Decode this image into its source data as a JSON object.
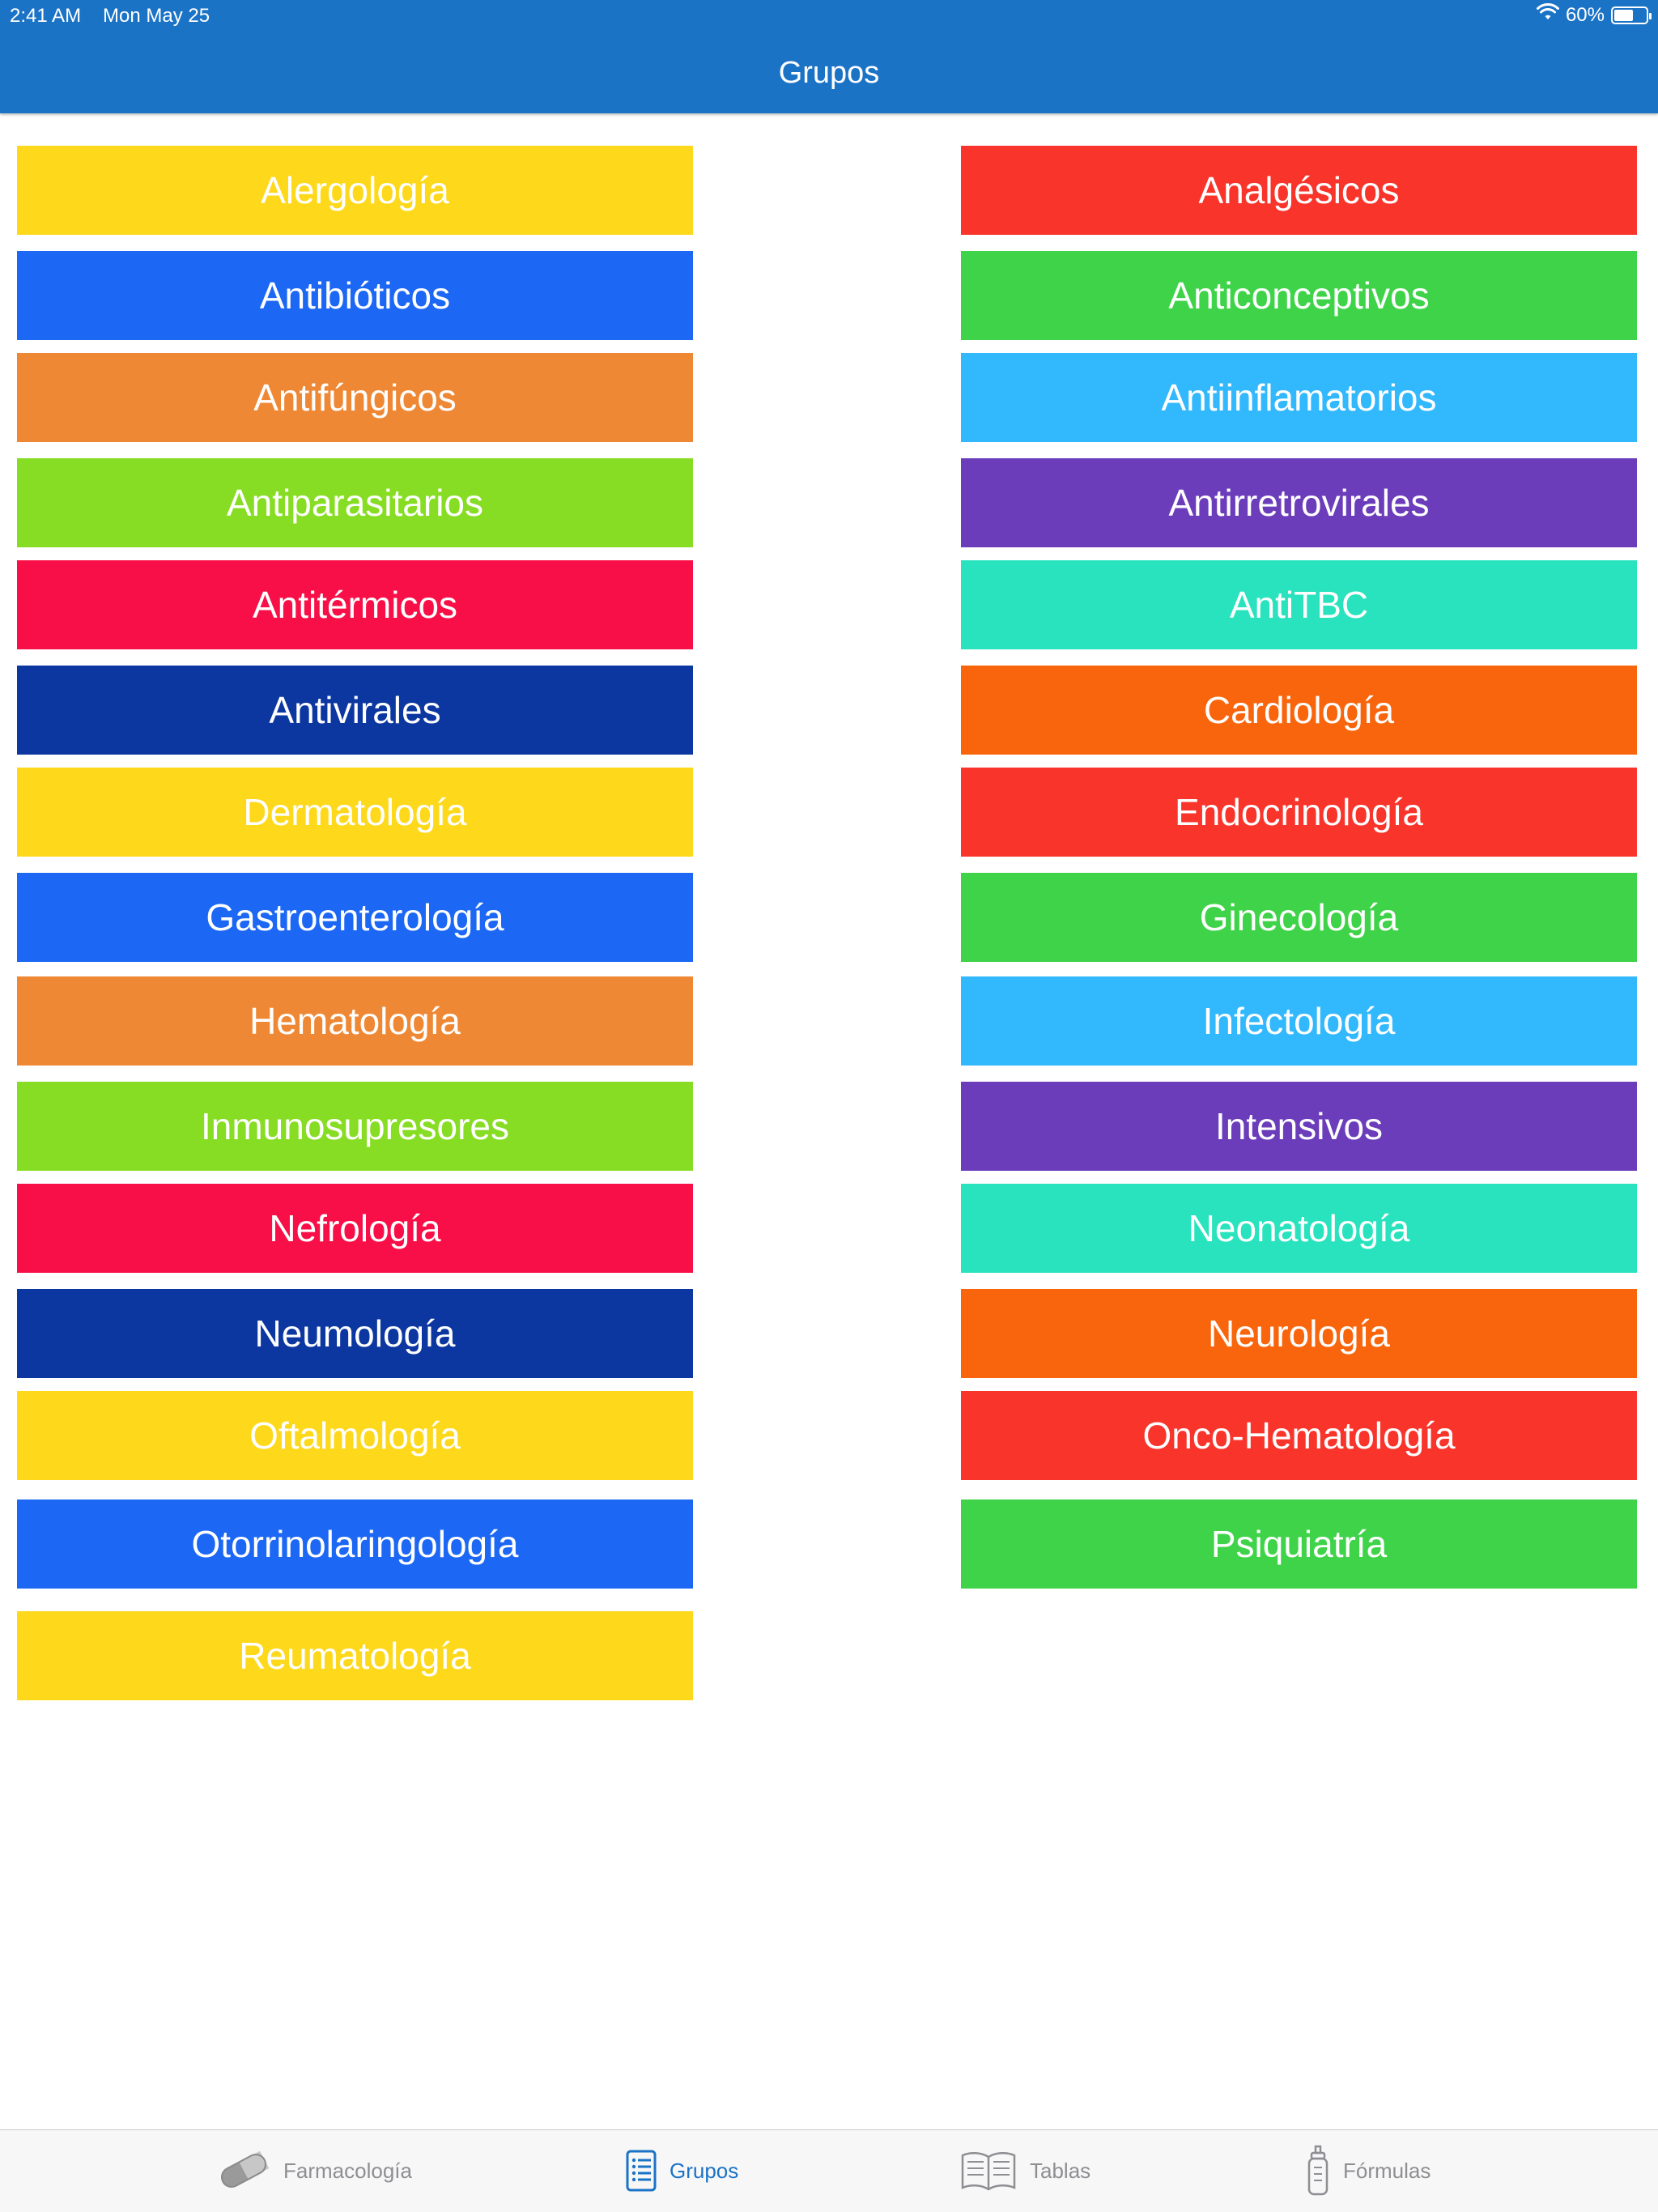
{
  "status": {
    "time": "2:41 AM",
    "date": "Mon May 25",
    "battery": "60%",
    "battery_level": 0.6
  },
  "nav": {
    "title": "Grupos"
  },
  "groups": {
    "left": [
      {
        "label": "Alergología",
        "color": "#fed81b"
      },
      {
        "label": "Antibióticos",
        "color": "#1c67f4"
      },
      {
        "label": "Antifúngicos",
        "color": "#ef8834"
      },
      {
        "label": "Antiparasitarios",
        "color": "#87dd23"
      },
      {
        "label": "Antitérmicos",
        "color": "#f80f47"
      },
      {
        "label": "Antivirales",
        "color": "#0c37a0"
      },
      {
        "label": "Dermatología",
        "color": "#fed81b"
      },
      {
        "label": "Gastroenterología",
        "color": "#1c67f4"
      },
      {
        "label": "Hematología",
        "color": "#ef8834"
      },
      {
        "label": "Inmunosupresores",
        "color": "#87dd23"
      },
      {
        "label": "Nefrología",
        "color": "#f80f47"
      },
      {
        "label": "Neumología",
        "color": "#0c37a0"
      },
      {
        "label": "Oftalmología",
        "color": "#fed81b"
      },
      {
        "label": "Otorrinolaringología",
        "color": "#1c67f4"
      },
      {
        "label": "Reumatología",
        "color": "#fed81b"
      }
    ],
    "right": [
      {
        "label": "Analgésicos",
        "color": "#f8342b"
      },
      {
        "label": "Anticonceptivos",
        "color": "#3fd349"
      },
      {
        "label": "Antiinflamatorios",
        "color": "#32b8fc"
      },
      {
        "label": "Antirretrovirales",
        "color": "#6b3dba"
      },
      {
        "label": "AntiTBC",
        "color": "#28e3bd"
      },
      {
        "label": "Cardiología",
        "color": "#f8650c"
      },
      {
        "label": "Endocrinología",
        "color": "#f8342b"
      },
      {
        "label": "Ginecología",
        "color": "#3fd349"
      },
      {
        "label": "Infectología",
        "color": "#32b8fc"
      },
      {
        "label": "Intensivos",
        "color": "#6b3dba"
      },
      {
        "label": "Neonatología",
        "color": "#28e3bd"
      },
      {
        "label": "Neurología",
        "color": "#f8650c"
      },
      {
        "label": "Onco-Hematología",
        "color": "#f8342b"
      },
      {
        "label": "Psiquiatría",
        "color": "#3fd349"
      }
    ]
  },
  "tabs": [
    {
      "label": "Farmacología",
      "icon": "pill-icon",
      "active": false
    },
    {
      "label": "Grupos",
      "icon": "list-icon",
      "active": true
    },
    {
      "label": "Tablas",
      "icon": "book-icon",
      "active": false
    },
    {
      "label": "Fórmulas",
      "icon": "baby-bottle-icon",
      "active": false
    }
  ],
  "colors": {
    "accent": "#1b73c6",
    "tab_inactive": "#8e8e93"
  }
}
